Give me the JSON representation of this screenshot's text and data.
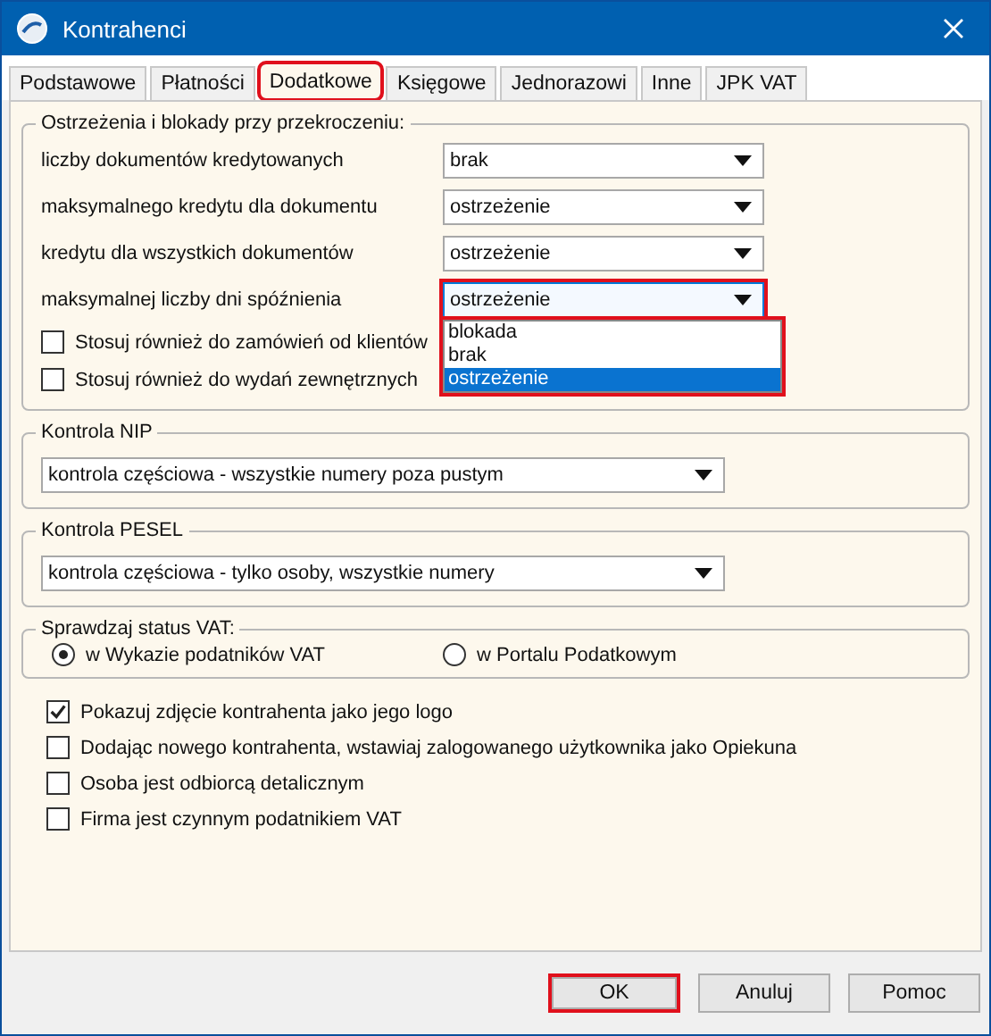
{
  "window": {
    "title": "Kontrahenci"
  },
  "tabs": [
    {
      "label": "Podstawowe",
      "selected": false,
      "highlighted": false
    },
    {
      "label": "Płatności",
      "selected": false,
      "highlighted": false
    },
    {
      "label": "Dodatkowe",
      "selected": true,
      "highlighted": true
    },
    {
      "label": "Księgowe",
      "selected": false,
      "highlighted": false
    },
    {
      "label": "Jednorazowi",
      "selected": false,
      "highlighted": false
    },
    {
      "label": "Inne",
      "selected": false,
      "highlighted": false
    },
    {
      "label": "JPK VAT",
      "selected": false,
      "highlighted": false
    }
  ],
  "warnings": {
    "title": "Ostrzeżenia i blokady przy przekroczeniu:",
    "rows": [
      {
        "label": "liczby dokumentów kredytowanych",
        "value": "brak",
        "expanded": false,
        "highlighted": false
      },
      {
        "label": "maksymalnego kredytu dla  dokumentu",
        "value": "ostrzeżenie",
        "expanded": false,
        "highlighted": false
      },
      {
        "label": "kredytu dla wszystkich dokumentów",
        "value": "ostrzeżenie",
        "expanded": false,
        "highlighted": false
      },
      {
        "label": "maksymalnej liczby dni spóźnienia",
        "value": "ostrzeżenie",
        "expanded": true,
        "highlighted": true,
        "options": [
          {
            "label": "blokada",
            "selected": false
          },
          {
            "label": "brak",
            "selected": false
          },
          {
            "label": "ostrzeżenie",
            "selected": true
          }
        ]
      }
    ],
    "checkboxes": [
      {
        "label": "Stosuj również do zamówień od klientów",
        "checked": false
      },
      {
        "label": "Stosuj również do wydań zewnętrznych",
        "checked": false
      }
    ]
  },
  "nip": {
    "title": "Kontrola NIP",
    "value": "kontrola częściowa - wszystkie numery poza pustym"
  },
  "pesel": {
    "title": "Kontrola PESEL",
    "value": "kontrola częściowa - tylko osoby, wszystkie numery"
  },
  "vat_status": {
    "title": "Sprawdzaj status VAT:",
    "options": [
      {
        "label": "w Wykazie podatników VAT",
        "selected": true
      },
      {
        "label": "w Portalu Podatkowym",
        "selected": false
      }
    ]
  },
  "checkboxes": [
    {
      "label": "Pokazuj zdjęcie kontrahenta jako jego logo",
      "checked": true
    },
    {
      "label": "Dodając nowego kontrahenta, wstawiaj zalogowanego użytkownika jako Opiekuna",
      "checked": false
    },
    {
      "label": "Osoba jest odbiorcą detalicznym",
      "checked": false
    },
    {
      "label": "Firma jest czynnym podatnikiem VAT",
      "checked": false
    }
  ],
  "buttons": [
    {
      "label": "OK",
      "highlighted": true
    },
    {
      "label": "Anuluj",
      "highlighted": false
    },
    {
      "label": "Pomoc",
      "highlighted": false
    }
  ]
}
